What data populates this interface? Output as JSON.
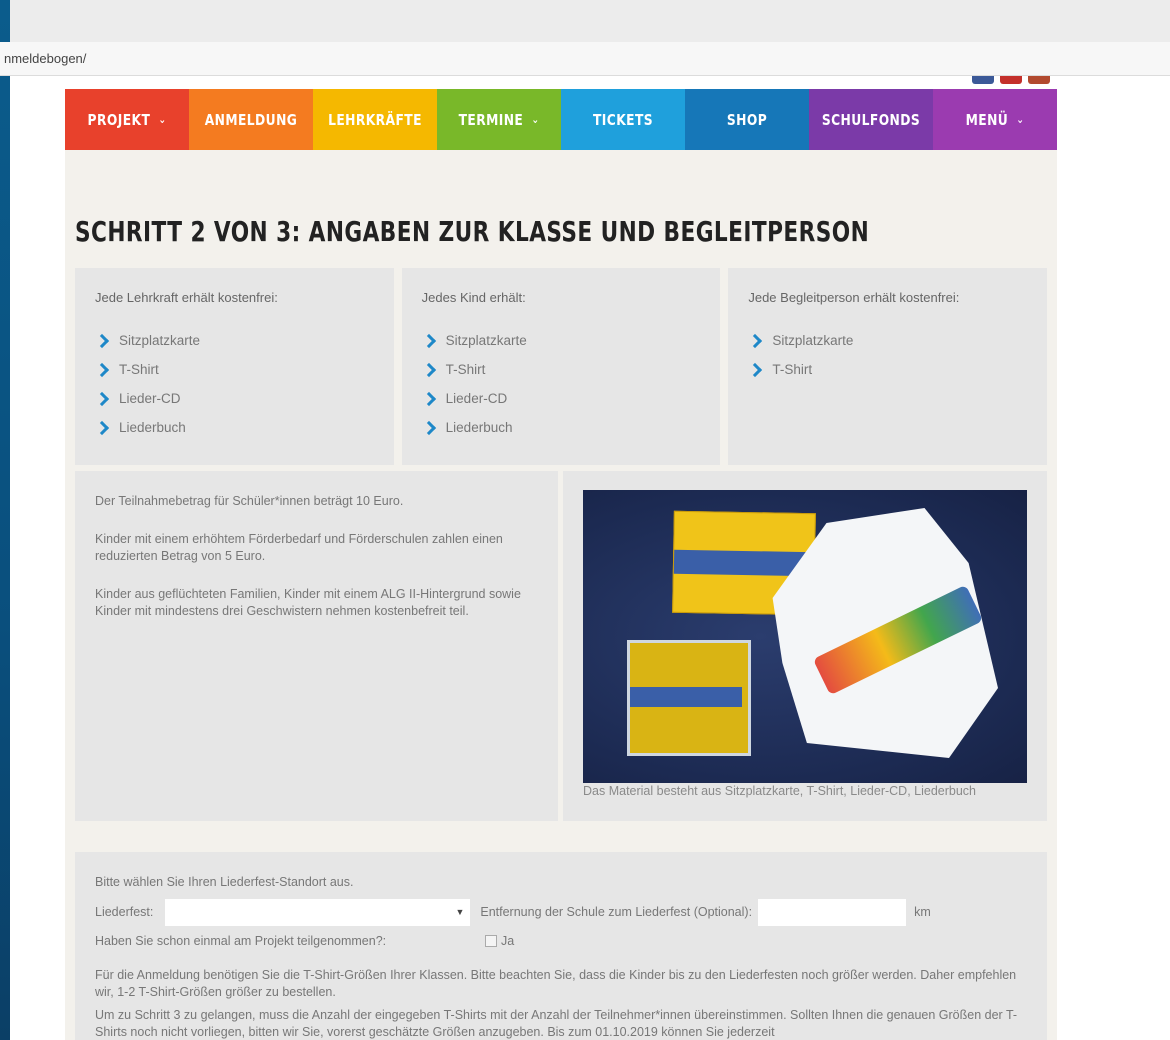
{
  "browser": {
    "url": "nmeldebogen/"
  },
  "social_colors": [
    "#3b5998",
    "#c4302b",
    "#b24a2f"
  ],
  "nav": {
    "items": [
      {
        "label": "PROJEKT",
        "chevron": true,
        "color": "#e8412c"
      },
      {
        "label": "ANMELDUNG",
        "chevron": false,
        "color": "#f47b20"
      },
      {
        "label": "LEHRKRÄFTE",
        "chevron": false,
        "color": "#f5b800"
      },
      {
        "label": "TERMINE",
        "chevron": true,
        "color": "#79b829"
      },
      {
        "label": "TICKETS",
        "chevron": false,
        "color": "#1fa0dc"
      },
      {
        "label": "SHOP",
        "chevron": false,
        "color": "#1677b8"
      },
      {
        "label": "SCHULFONDS",
        "chevron": false,
        "color": "#7b3aa8"
      },
      {
        "label": "MENÜ",
        "chevron": true,
        "color": "#9b3bb0"
      }
    ],
    "chevron_glyph": "⌄"
  },
  "page_title": "SCHRITT 2 VON 3: ANGABEN ZUR KLASSE UND BEGLEITPERSON",
  "benefits": [
    {
      "intro": "Jede Lehrkraft erhält kostenfrei:",
      "items": [
        "Sitzplatzkarte",
        "T-Shirt",
        "Lieder-CD",
        "Liederbuch"
      ]
    },
    {
      "intro": "Jedes Kind erhält:",
      "items": [
        "Sitzplatzkarte",
        "T-Shirt",
        "Lieder-CD",
        "Liederbuch"
      ]
    },
    {
      "intro": "Jede Begleitperson erhält kostenfrei:",
      "items": [
        "Sitzplatzkarte",
        "T-Shirt"
      ]
    }
  ],
  "fees": {
    "p1": "Der Teilnahmebetrag für Schüler*innen beträgt 10 Euro.",
    "p2": "Kinder mit einem erhöhtem Förderbedarf und Förderschulen zahlen einen reduzierten Betrag von 5 Euro.",
    "p3": "Kinder aus geflüchteten Familien, Kinder mit einem ALG II-Hintergrund sowie Kinder mit mindestens drei Geschwistern nehmen kostenbefreit teil."
  },
  "image": {
    "caption": "Das Material besteht aus Sitzplatzkarte, T-Shirt, Lieder-CD, Liederbuch"
  },
  "form": {
    "intro": "Bitte wählen Sie Ihren Liederfest-Standort aus.",
    "liederfest_label": "Liederfest:",
    "liederfest_value": "",
    "select_arrow": "▼",
    "distance_label": "Entfernung der Schule zum Liederfest (Optional):",
    "distance_value": "",
    "distance_unit": "km",
    "participated_label": "Haben Sie schon einmal am Projekt teilgenommen?:",
    "participated_option": "Ja",
    "info1": "Für die Anmeldung benötigen Sie die T-Shirt-Größen Ihrer Klassen. Bitte beachten Sie, dass die Kinder bis zu den Liederfesten noch größer werden. Daher empfehlen wir, 1-2 T-Shirt-Größen größer zu bestellen.",
    "info2": "Um zu Schritt 3 zu gelangen, muss die Anzahl der eingegeben T-Shirts mit der Anzahl der Teilnehmer*innen übereinstimmen. Sollten Ihnen die genauen Größen der T-Shirts noch nicht vorliegen, bitten wir Sie, vorerst geschätzte Größen anzugeben. Bis zum 01.10.2019 können Sie jederzeit"
  }
}
